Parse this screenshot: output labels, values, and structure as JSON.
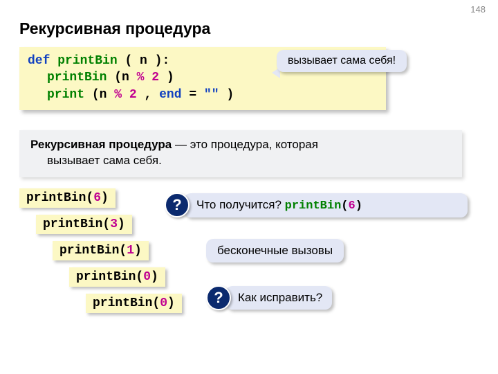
{
  "page_number": "148",
  "title": "Рекурсивная процедура",
  "code": {
    "def": "def",
    "fname": "printBin",
    "sig_open": "( n ):",
    "line2_call": "printBin",
    "line2_open": "(n",
    "line2_op": " % ",
    "line2_num": "2",
    "line2_close": ")",
    "line3_print": "print",
    "line3_open": "(n",
    "line3_op": " % ",
    "line3_num": "2",
    "line3_mid": ", ",
    "line3_end_kw": "end",
    "line3_eq": " = ",
    "line3_quote": "\"\"",
    "line3_close": ")"
  },
  "callout": "вызывает сама себя!",
  "definition": {
    "term": "Рекурсивная процедура",
    "rest": " — это процедура, которая",
    "cont": "вызывает сама себя."
  },
  "stack": [
    {
      "fn": "printBin",
      "open": "(",
      "arg": "6",
      "close": ")"
    },
    {
      "fn": "printBin",
      "open": "(",
      "arg": "3",
      "close": ")"
    },
    {
      "fn": "printBin",
      "open": "(",
      "arg": "1",
      "close": ")"
    },
    {
      "fn": "printBin",
      "open": "(",
      "arg": "0",
      "close": ")"
    },
    {
      "fn": "printBin",
      "open": "(",
      "arg": "0",
      "close": ")"
    }
  ],
  "question1": {
    "mark": "?",
    "text": "Что получится? ",
    "call_fn": "printBin",
    "call_open": "(",
    "call_arg": "6",
    "call_close": ")"
  },
  "note_infinite": "бесконечные вызовы",
  "question2": {
    "mark": "?",
    "text": "Как исправить?"
  }
}
